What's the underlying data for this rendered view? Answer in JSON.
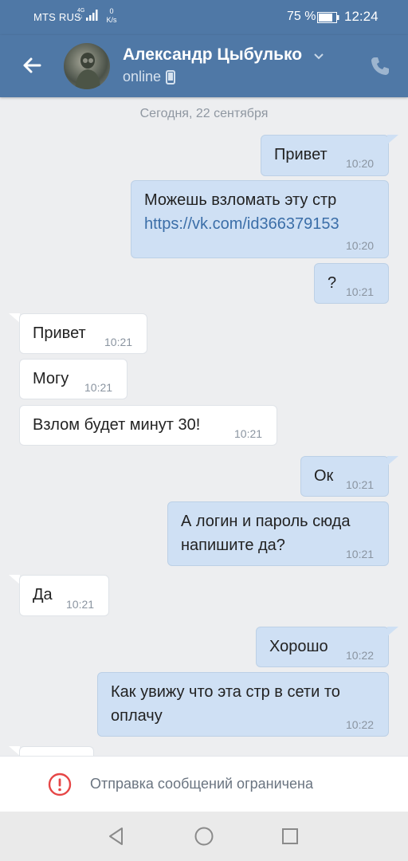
{
  "status_bar": {
    "carrier": "MTS RUS",
    "network": "4G",
    "network_sub": "↑↓",
    "speed_value": "0",
    "speed_unit": "K/s",
    "battery": "75 %",
    "time": "12:24"
  },
  "header": {
    "contact_name": "Александр Цыбулько",
    "presence": "online",
    "icons": [
      "back-arrow-icon",
      "chevron-down-icon",
      "mobile-phone-icon",
      "call-icon"
    ]
  },
  "chat": {
    "date_label": "Сегодня, 22 сентября",
    "messages": [
      {
        "direction": "out",
        "text": "Привет",
        "time": "10:20"
      },
      {
        "direction": "out",
        "text": "Можешь взломать эту стр",
        "link": "https://vk.com/id366379153",
        "time": "10:20"
      },
      {
        "direction": "out",
        "text": "?",
        "time": "10:21"
      },
      {
        "direction": "in",
        "text": "Привет",
        "time": "10:21"
      },
      {
        "direction": "in",
        "text": "Могу",
        "time": "10:21"
      },
      {
        "direction": "in",
        "text": "Взлом будет минут 30!",
        "time": "10:21"
      },
      {
        "direction": "out",
        "text": "Ок",
        "time": "10:21"
      },
      {
        "direction": "out",
        "text": "А логин и пароль сюда",
        "text2": "напишите да?",
        "time": "10:21"
      },
      {
        "direction": "in",
        "text": "Да",
        "time": "10:21"
      },
      {
        "direction": "out",
        "text": "Хорошо",
        "time": "10:22"
      },
      {
        "direction": "out",
        "text": "Как увижу что эта стр в сети то",
        "text2": "оплачу",
        "time": "10:22"
      }
    ]
  },
  "footer": {
    "restriction_text": "Отправка сообщений ограничена",
    "icon": "warning-circle-icon"
  },
  "colors": {
    "header": "#4f78a6",
    "outgoing_bubble": "#cfe0f4",
    "incoming_bubble": "#ffffff",
    "background": "#edeef0",
    "warning": "#e64646",
    "link": "#3b6ea8"
  }
}
